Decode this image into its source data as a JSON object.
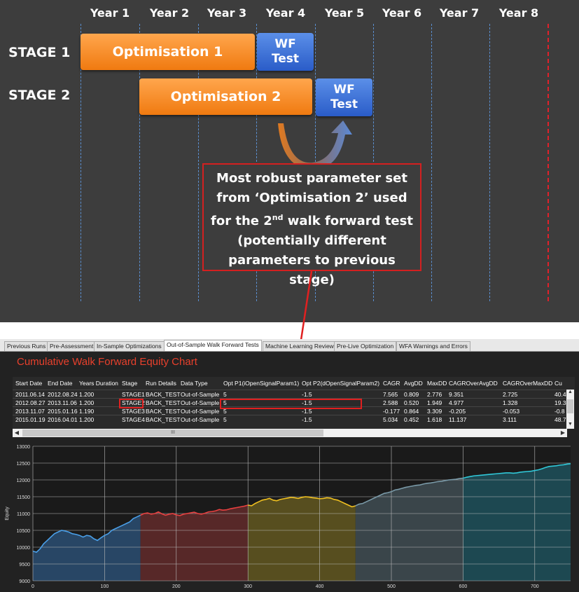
{
  "years": [
    "Year 1",
    "Year 2",
    "Year 3",
    "Year 4",
    "Year 5",
    "Year 6",
    "Year 7",
    "Year 8"
  ],
  "stages": [
    "STAGE 1",
    "STAGE 2"
  ],
  "optimisations": [
    "Optimisation 1",
    "Optimisation 2"
  ],
  "wf_test": {
    "line1": "WF",
    "line2": "Test"
  },
  "callout": {
    "line1": "Most robust parameter set",
    "line2": "from ‘Optimisation 2’ used",
    "line3a": "for the 2",
    "line3sup": "nd",
    "line3b": " walk forward test",
    "line4": "(potentially different",
    "line5": "parameters to previous stage)"
  },
  "tabs": [
    "Previous Runs",
    "Pre-Assessment",
    "In-Sample Optimizations",
    "Out-of-Sample Walk Forward Tests",
    "Machine Learning Review",
    "Pre-Live Optimization",
    "WFA Warnings and Errors"
  ],
  "active_tab": "Out-of-Sample Walk Forward Tests",
  "chart_title": "Cumulative Walk Forward Equity Chart",
  "table": {
    "headers": [
      "Start Date",
      "End Date",
      "Years Duration",
      "Stage",
      "Run Details",
      "Data Type",
      "Opt P1(iOpenSignalParam1)",
      "Opt P2(dOpenSignalParam2)",
      "CAGR",
      "AvgDD",
      "MaxDD",
      "CAGROverAvgDD",
      "CAGROverMaxDD",
      "Cu"
    ],
    "rows": [
      [
        "2011.06.14",
        "2012.08.24",
        "1.200",
        "STAGE1",
        "BACK_TEST",
        "Out-of-Sample",
        "5",
        "-1.5",
        "7.565",
        "0.809",
        "2.776",
        "9.351",
        "2.725",
        "40.4"
      ],
      [
        "2012.08.27",
        "2013.11.06",
        "1.200",
        "STAGE2",
        "BACK_TEST",
        "Out-of-Sample",
        "5",
        "-1.5",
        "2.588",
        "0.520",
        "1.949",
        "4.977",
        "1.328",
        "19.3"
      ],
      [
        "2013.11.07",
        "2015.01.16",
        "1.190",
        "STAGE3",
        "BACK_TEST",
        "Out-of-Sample",
        "5",
        "-1.5",
        "-0.177",
        "0.864",
        "3.309",
        "-0.205",
        "-0.053",
        "-0.8"
      ],
      [
        "2015.01.19",
        "2016.04.01",
        "1.200",
        "STAGE4",
        "BACK_TEST",
        "Out-of-Sample",
        "5",
        "-1.5",
        "5.034",
        "0.452",
        "1.618",
        "11.137",
        "3.111",
        "48.7"
      ]
    ],
    "scroll_glyph": "III"
  },
  "chart_data": {
    "type": "line",
    "title": "",
    "xlabel": "",
    "ylabel": "Equity",
    "xlim": [
      0,
      750
    ],
    "ylim": [
      9000,
      13000
    ],
    "x_ticks": [
      0,
      100,
      200,
      300,
      400,
      500,
      600,
      700
    ],
    "y_ticks": [
      9000,
      9500,
      10000,
      10500,
      11000,
      11500,
      12000,
      12500,
      13000
    ],
    "grid": true,
    "segments": [
      {
        "stage": "STAGE1",
        "x_range": [
          0,
          150
        ],
        "color": "#4a9fe8",
        "fill": "#2a4b6e"
      },
      {
        "stage": "STAGE2",
        "x_range": [
          150,
          300
        ],
        "color": "#e84040",
        "fill": "#5e2a2a"
      },
      {
        "stage": "STAGE3",
        "x_range": [
          300,
          450
        ],
        "color": "#f0c020",
        "fill": "#5e5420"
      },
      {
        "stage": "STAGE4",
        "x_range": [
          450,
          600
        ],
        "color": "#7a9aa8",
        "fill": "#3e4a50"
      },
      {
        "stage": "STAGE5",
        "x_range": [
          600,
          750
        ],
        "color": "#30c8d8",
        "fill": "#1e4e58"
      }
    ],
    "points": [
      [
        0,
        9880
      ],
      [
        5,
        9850
      ],
      [
        10,
        9950
      ],
      [
        15,
        10100
      ],
      [
        20,
        10200
      ],
      [
        25,
        10300
      ],
      [
        30,
        10400
      ],
      [
        35,
        10450
      ],
      [
        40,
        10500
      ],
      [
        45,
        10480
      ],
      [
        50,
        10450
      ],
      [
        55,
        10400
      ],
      [
        60,
        10380
      ],
      [
        65,
        10350
      ],
      [
        70,
        10300
      ],
      [
        75,
        10350
      ],
      [
        80,
        10330
      ],
      [
        85,
        10250
      ],
      [
        90,
        10200
      ],
      [
        95,
        10280
      ],
      [
        100,
        10350
      ],
      [
        105,
        10400
      ],
      [
        110,
        10500
      ],
      [
        115,
        10550
      ],
      [
        120,
        10600
      ],
      [
        125,
        10650
      ],
      [
        130,
        10700
      ],
      [
        135,
        10750
      ],
      [
        140,
        10850
      ],
      [
        145,
        10900
      ],
      [
        150,
        10950
      ],
      [
        155,
        11000
      ],
      [
        160,
        11020
      ],
      [
        165,
        10980
      ],
      [
        170,
        11000
      ],
      [
        175,
        11050
      ],
      [
        180,
        10990
      ],
      [
        185,
        10950
      ],
      [
        190,
        10980
      ],
      [
        195,
        11000
      ],
      [
        200,
        10960
      ],
      [
        205,
        10940
      ],
      [
        210,
        10980
      ],
      [
        215,
        11000
      ],
      [
        220,
        11020
      ],
      [
        225,
        11040
      ],
      [
        230,
        11000
      ],
      [
        235,
        10980
      ],
      [
        240,
        11010
      ],
      [
        245,
        11050
      ],
      [
        250,
        11060
      ],
      [
        255,
        11080
      ],
      [
        260,
        11120
      ],
      [
        265,
        11100
      ],
      [
        270,
        11110
      ],
      [
        275,
        11140
      ],
      [
        280,
        11160
      ],
      [
        285,
        11180
      ],
      [
        290,
        11200
      ],
      [
        295,
        11220
      ],
      [
        300,
        11250
      ],
      [
        305,
        11230
      ],
      [
        310,
        11300
      ],
      [
        315,
        11350
      ],
      [
        320,
        11400
      ],
      [
        325,
        11420
      ],
      [
        330,
        11450
      ],
      [
        335,
        11400
      ],
      [
        340,
        11380
      ],
      [
        345,
        11420
      ],
      [
        350,
        11440
      ],
      [
        355,
        11460
      ],
      [
        360,
        11480
      ],
      [
        365,
        11470
      ],
      [
        370,
        11450
      ],
      [
        375,
        11480
      ],
      [
        380,
        11500
      ],
      [
        385,
        11490
      ],
      [
        390,
        11470
      ],
      [
        395,
        11460
      ],
      [
        400,
        11440
      ],
      [
        405,
        11450
      ],
      [
        410,
        11470
      ],
      [
        415,
        11460
      ],
      [
        420,
        11420
      ],
      [
        425,
        11400
      ],
      [
        430,
        11350
      ],
      [
        435,
        11300
      ],
      [
        440,
        11250
      ],
      [
        445,
        11200
      ],
      [
        450,
        11230
      ],
      [
        455,
        11280
      ],
      [
        460,
        11300
      ],
      [
        465,
        11350
      ],
      [
        470,
        11400
      ],
      [
        475,
        11450
      ],
      [
        480,
        11500
      ],
      [
        485,
        11550
      ],
      [
        490,
        11600
      ],
      [
        495,
        11620
      ],
      [
        500,
        11650
      ],
      [
        505,
        11700
      ],
      [
        510,
        11720
      ],
      [
        515,
        11750
      ],
      [
        520,
        11780
      ],
      [
        525,
        11800
      ],
      [
        530,
        11820
      ],
      [
        535,
        11840
      ],
      [
        540,
        11850
      ],
      [
        545,
        11880
      ],
      [
        550,
        11900
      ],
      [
        555,
        11910
      ],
      [
        560,
        11930
      ],
      [
        565,
        11950
      ],
      [
        570,
        11960
      ],
      [
        575,
        11980
      ],
      [
        580,
        12000
      ],
      [
        585,
        12010
      ],
      [
        590,
        12020
      ],
      [
        595,
        12040
      ],
      [
        600,
        12050
      ],
      [
        605,
        12080
      ],
      [
        610,
        12100
      ],
      [
        615,
        12120
      ],
      [
        620,
        12130
      ],
      [
        625,
        12140
      ],
      [
        630,
        12150
      ],
      [
        635,
        12160
      ],
      [
        640,
        12170
      ],
      [
        645,
        12180
      ],
      [
        650,
        12190
      ],
      [
        655,
        12200
      ],
      [
        660,
        12210
      ],
      [
        665,
        12210
      ],
      [
        670,
        12200
      ],
      [
        675,
        12210
      ],
      [
        680,
        12230
      ],
      [
        685,
        12240
      ],
      [
        690,
        12250
      ],
      [
        695,
        12260
      ],
      [
        700,
        12280
      ],
      [
        705,
        12300
      ],
      [
        710,
        12330
      ],
      [
        715,
        12370
      ],
      [
        720,
        12400
      ],
      [
        725,
        12410
      ],
      [
        730,
        12420
      ],
      [
        735,
        12440
      ],
      [
        740,
        12450
      ],
      [
        745,
        12470
      ],
      [
        750,
        12480
      ]
    ]
  }
}
